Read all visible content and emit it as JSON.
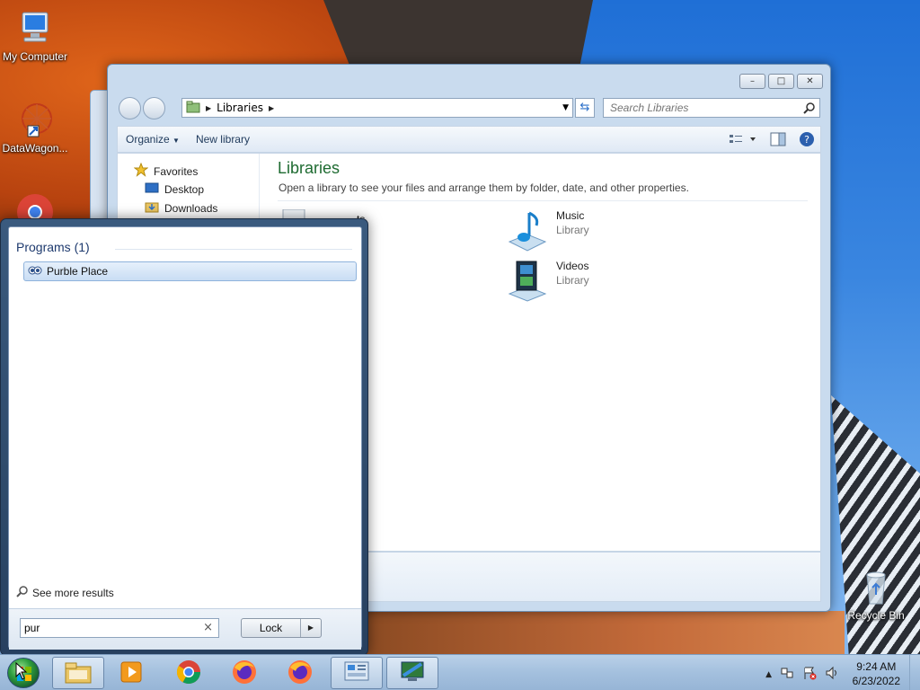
{
  "desktop": {
    "icons": [
      {
        "label": "My Computer",
        "icon": "computer-icon"
      },
      {
        "label": "DataWagon...",
        "icon": "datawagon-icon"
      },
      {
        "label": "Recycle Bin",
        "icon": "recycle-bin-icon"
      }
    ]
  },
  "explorer": {
    "caption": {
      "minimize": "–",
      "maximize": "□",
      "close": "✕"
    },
    "address": {
      "crumb": "Libraries"
    },
    "search": {
      "placeholder": "Search Libraries"
    },
    "toolbar": {
      "organize": "Organize",
      "new_library": "New library"
    },
    "nav": {
      "favorites": "Favorites",
      "items": [
        "Desktop",
        "Downloads"
      ]
    },
    "main": {
      "title": "Libraries",
      "subtitle": "Open a library to see your files and arrange them by folder, date, and other properties.",
      "libraries": [
        {
          "name": "ts",
          "type": ""
        },
        {
          "name": "Music",
          "type": "Library"
        },
        {
          "name": "Videos",
          "type": "Library"
        }
      ]
    }
  },
  "start_menu": {
    "programs_header": "Programs (1)",
    "results": [
      {
        "label": "Purble Place",
        "icon": "purble-place-icon"
      }
    ],
    "see_more": "See more results",
    "search_value": "pur",
    "clear_glyph": "×",
    "lock_label": "Lock",
    "lock_arrow": "▶"
  },
  "taskbar": {
    "buttons": [
      {
        "name": "explorer",
        "icon": "folder-icon"
      },
      {
        "name": "media-player",
        "icon": "media-player-icon"
      },
      {
        "name": "chrome",
        "icon": "chrome-icon"
      },
      {
        "name": "firefox",
        "icon": "firefox-icon"
      },
      {
        "name": "firefox-2",
        "icon": "firefox-icon"
      },
      {
        "name": "control-panel",
        "icon": "control-panel-icon"
      },
      {
        "name": "remote",
        "icon": "remote-desktop-icon"
      }
    ],
    "tray_arrow": "▲",
    "time": "9:24 AM",
    "date": "6/23/2022"
  }
}
